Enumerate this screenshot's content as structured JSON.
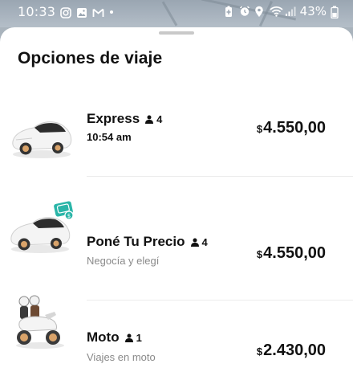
{
  "status_bar": {
    "time": "10:33",
    "battery": "43%",
    "left_icons": [
      "instagram-icon",
      "gallery-icon",
      "gmail-icon"
    ],
    "right_icons": [
      "battery-saver-icon",
      "alarm-icon",
      "location-icon",
      "wifi-icon",
      "signal-icon",
      "battery-icon"
    ]
  },
  "sheet": {
    "title": "Opciones de viaje"
  },
  "options": [
    {
      "name": "Express",
      "seats": "4",
      "subtitle": "10:54 am",
      "currency": "$",
      "price": "4.550,00",
      "image": "white-car-image"
    },
    {
      "name": "Poné Tu Precio",
      "seats": "4",
      "subtitle": "Negocía y elegí",
      "currency": "$",
      "price": "4.550,00",
      "image": "white-car-with-money-badge-image",
      "badge_color": "#2ab5a8"
    },
    {
      "name": "Moto",
      "seats": "1",
      "subtitle": "Viajes en moto",
      "currency": "$",
      "price": "2.430,00",
      "image": "motorcycle-riders-image"
    }
  ]
}
